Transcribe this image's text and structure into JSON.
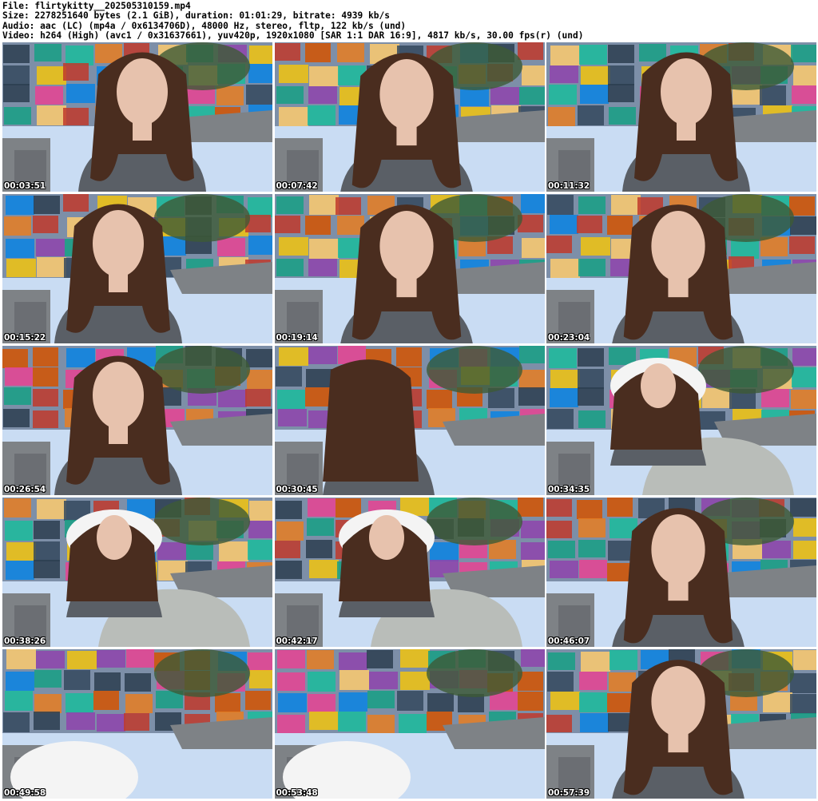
{
  "header": {
    "file": "File: flirtykitty__202505310159.mp4",
    "size": "Size: 2278251640 bytes (2.1 GiB), duration: 01:01:29, bitrate: 4939 kb/s",
    "audio": "Audio: aac (LC) (mp4a / 0x6134706D), 48000 Hz, stereo, fltp, 122 kb/s (und)",
    "video": "Video: h264 (High) (avc1 / 0x31637661), yuv420p, 1920x1080 [SAR 1:1 DAR 16:9], 4817 kb/s, 30.00 fps(r) (und)"
  },
  "colors": {
    "wall": "#7d8fa8",
    "bed": "#c9dcf3",
    "pillow": "#f4f4f4",
    "sofa": "#7e8286",
    "hair": "#4a2d1f",
    "skin": "#e7c2ad",
    "shirt": "#5a5f66",
    "leggings": "#b9bdb9",
    "plant": "#3d5a36",
    "keyboard": "#6b6e73"
  },
  "frames": [
    {
      "time": "00:03:51",
      "scene": "closeup-right"
    },
    {
      "time": "00:07:42",
      "scene": "closeup-center"
    },
    {
      "time": "00:11:32",
      "scene": "closeup-right"
    },
    {
      "time": "00:15:22",
      "scene": "closeup-left"
    },
    {
      "time": "00:19:14",
      "scene": "closeup-center"
    },
    {
      "time": "00:23:04",
      "scene": "closeup-center"
    },
    {
      "time": "00:26:54",
      "scene": "closeup-left"
    },
    {
      "time": "00:30:45",
      "scene": "turned-away"
    },
    {
      "time": "00:34:35",
      "scene": "reclining"
    },
    {
      "time": "00:38:26",
      "scene": "reclining"
    },
    {
      "time": "00:42:17",
      "scene": "reclining"
    },
    {
      "time": "00:46:07",
      "scene": "closeup-center"
    },
    {
      "time": "00:49:58",
      "scene": "empty-room"
    },
    {
      "time": "00:53:48",
      "scene": "empty-room"
    },
    {
      "time": "00:57:39",
      "scene": "closeup-center"
    }
  ]
}
